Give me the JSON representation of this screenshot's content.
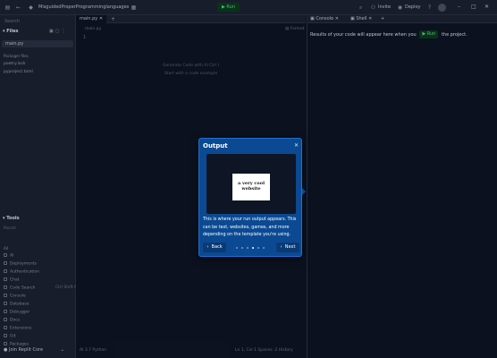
{
  "topbar": {
    "repl_name": "MisguidedProperProgramminglanguages",
    "run_label": "Run",
    "invite_label": "Invite",
    "deploy_label": "Deploy"
  },
  "sidebar": {
    "search_placeholder": "Search",
    "files_header": "Files",
    "files": [
      "main.py"
    ],
    "packager_header": "Packager files",
    "packager_files": [
      "poetry.lock",
      "pyproject.toml"
    ],
    "tools_header": "Tools",
    "tools_sub": "Recent",
    "tools_all": "All",
    "tools": [
      {
        "label": "AI",
        "shortcut": ""
      },
      {
        "label": "Deployments",
        "shortcut": ""
      },
      {
        "label": "Authentication",
        "shortcut": ""
      },
      {
        "label": "Chat",
        "shortcut": ""
      },
      {
        "label": "Code Search",
        "shortcut": "Ctrl Shift F"
      },
      {
        "label": "Console",
        "shortcut": ""
      },
      {
        "label": "Database",
        "shortcut": ""
      },
      {
        "label": "Debugger",
        "shortcut": ""
      },
      {
        "label": "Docs",
        "shortcut": ""
      },
      {
        "label": "Extensions",
        "shortcut": ""
      },
      {
        "label": "Git",
        "shortcut": ""
      },
      {
        "label": "Packages",
        "shortcut": ""
      }
    ],
    "user_label": "Join Replit Core"
  },
  "editor": {
    "tab_label": "main.py",
    "breadcrumb": "main.py",
    "format_label": "Format",
    "line_number": "1",
    "hint_ai": "Generate Code with AI  Ctrl I",
    "hint_template": "Start with a code example",
    "status_left": "AI   3.7 Python",
    "status_right": "Ln 1, Col 1   Spaces: 2   History"
  },
  "right_panel": {
    "tabs": [
      "Console",
      "Shell"
    ],
    "message_before": "Results of your code will appear here when you",
    "message_run": "Run",
    "message_after": "the project."
  },
  "modal": {
    "title": "Output",
    "illustration_text": "a very cool website",
    "body": "This is where your run output appears. This can be text, websites, games, and more depending on the template you're using.",
    "back_label": "Back",
    "next_label": "Next",
    "steps_total": 6,
    "current_step": 4
  },
  "colors": {
    "modal_bg": "#0b4a92",
    "run_green": "#5fd38d",
    "app_bg": "#0e1525"
  }
}
